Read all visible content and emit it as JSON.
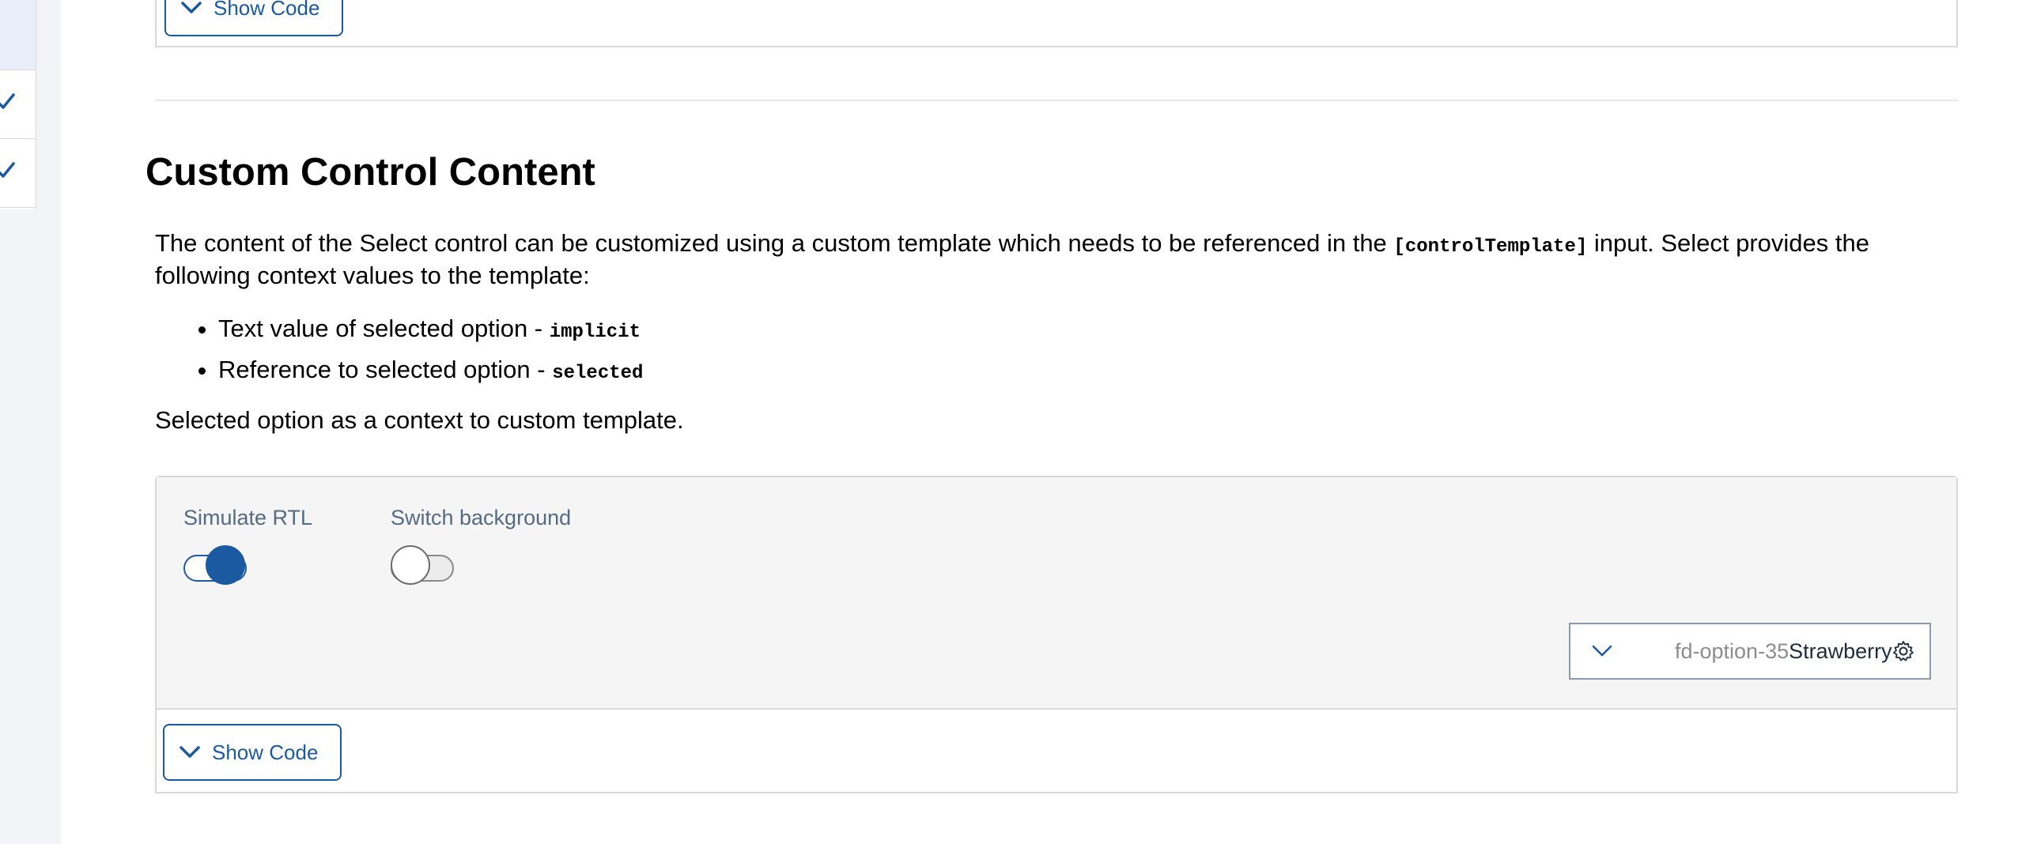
{
  "sidebar": {
    "items": [
      {
        "checked": false
      },
      {
        "checked": true
      },
      {
        "checked": true
      }
    ]
  },
  "previous_example": {
    "show_code_label": "Show Code"
  },
  "section": {
    "title": "Custom Control Content",
    "description_part1": "The content of the Select control can be customized using a custom template which needs to be referenced in the ",
    "description_code": "[controlTemplate]",
    "description_part2": " input. Select provides the following context values to the template:",
    "context_items": [
      {
        "text": "Text value of selected option - ",
        "code": "implicit"
      },
      {
        "text": "Reference to selected option - ",
        "code": "selected"
      }
    ],
    "after_text": "Selected option as a context to custom template."
  },
  "example": {
    "toggles": [
      {
        "label": "Simulate RTL",
        "on": true
      },
      {
        "label": "Switch background",
        "on": false
      }
    ],
    "select": {
      "option_id": "fd-option-35",
      "option_value": "Strawberry",
      "chevron_icon": "chevron-down-icon",
      "trailing_icon": "gear-icon"
    },
    "show_code_label": "Show Code"
  },
  "colors": {
    "accent": "#1b5aa0",
    "card_bg": "#f5f5f5",
    "border": "#d9d9d9",
    "sidebar_bg": "#f2f4f7"
  }
}
